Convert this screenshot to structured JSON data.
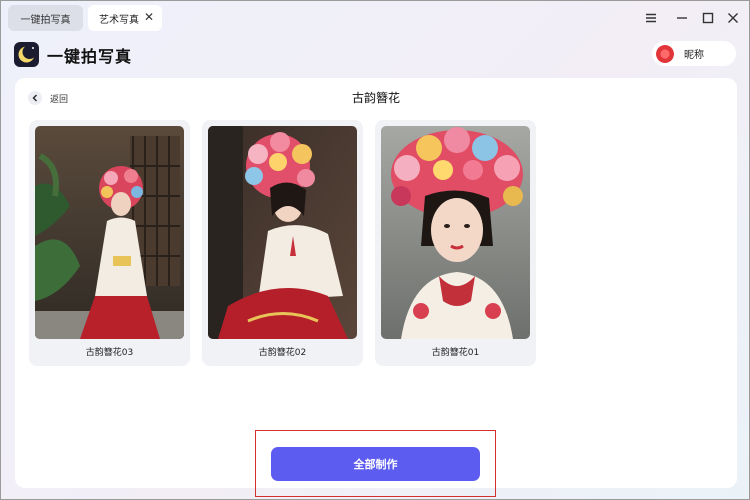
{
  "tabs": [
    {
      "label": "一键拍写真"
    },
    {
      "label": "艺术写真",
      "close_glyph": "✕"
    }
  ],
  "window_controls": [
    "menu-icon",
    "minimize-icon",
    "maximize-icon",
    "close-icon"
  ],
  "app": {
    "title": "一键拍写真",
    "logo_icon": "moon-logo-icon"
  },
  "user": {
    "nickname": "昵称",
    "avatar_icon": "flower-avatar-icon"
  },
  "panel": {
    "back_label": "返回",
    "title": "古韵簪花",
    "cards": [
      {
        "label": "古韵簪花03"
      },
      {
        "label": "古韵簪花02"
      },
      {
        "label": "古韵簪花01"
      }
    ],
    "make_all_label": "全部制作"
  },
  "colors": {
    "accent": "#5c5cf0",
    "highlight": "#d23030",
    "card_bg": "#f1f2f6"
  }
}
